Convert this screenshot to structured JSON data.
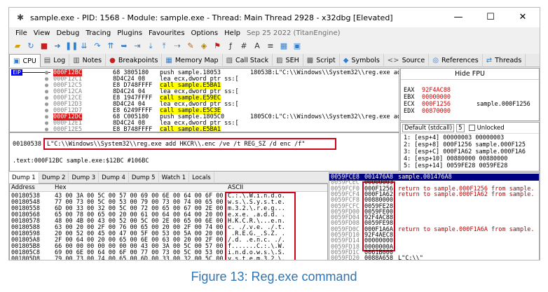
{
  "window": {
    "title": "sample.exe - PID: 1568 - Module: sample.exe - Thread: Main Thread 2928 - x32dbg [Elevated]",
    "minimize_glyph": "—",
    "maximize_glyph": "☐",
    "close_glyph": "✕"
  },
  "menu": {
    "items": [
      "File",
      "View",
      "Debug",
      "Tracing",
      "Plugins",
      "Favourites",
      "Options",
      "Help"
    ],
    "build_date": "Sep 25 2022 (TitanEngine)"
  },
  "toolbar": {
    "icons": [
      "open-icon",
      "restart-icon",
      "close-icon",
      "run-icon",
      "pause-icon",
      "step-into-icon",
      "step-over-icon",
      "step-out-icon",
      "run-to-user-icon",
      "animate-icon",
      "trace-icon",
      "script-icon",
      "patch-icon",
      "comment-icon",
      "label-icon",
      "bookmark-icon",
      "function-icon",
      "hash-icon",
      "font-icon",
      "string-icon",
      "calculator-icon",
      "log-icon"
    ]
  },
  "tabs": [
    {
      "label": "CPU",
      "active": true,
      "icon": "▣"
    },
    {
      "label": "Log",
      "active": false,
      "icon": "▤"
    },
    {
      "label": "Notes",
      "active": false,
      "icon": "▥"
    },
    {
      "label": "Breakpoints",
      "active": false,
      "icon": "●"
    },
    {
      "label": "Memory Map",
      "active": false,
      "icon": "▦"
    },
    {
      "label": "Call Stack",
      "active": false,
      "icon": "▧"
    },
    {
      "label": "SEH",
      "active": false,
      "icon": "▨"
    },
    {
      "label": "Script",
      "active": false,
      "icon": "▩"
    },
    {
      "label": "Symbols",
      "active": false,
      "icon": "◆"
    },
    {
      "label": "Source",
      "active": false,
      "icon": "<>"
    },
    {
      "label": "References",
      "active": false,
      "icon": "◎"
    },
    {
      "label": "Threads",
      "active": false,
      "icon": "⇄"
    }
  ],
  "disasm": {
    "eip_label": "EIP",
    "rows": [
      {
        "addr": "000F12BC",
        "bytes": "68 3805180",
        "ins": "push sample.18053",
        "cmt": "18053B:L\"C:\\\\Windows\\\\System32\\\\reg.exe ad",
        "addr_style": "eip"
      },
      {
        "addr": "000F12C1",
        "bytes": "8D4C24 08",
        "ins": "lea ecx,dword ptr ss:[",
        "cmt": ""
      },
      {
        "addr": "000F12C5",
        "bytes": "E8 D748FFFF",
        "ins": "call sample.E5BA1",
        "cmt": "",
        "call": true
      },
      {
        "addr": "000F12CA",
        "bytes": "8D4C24 04",
        "ins": "lea ecx,dword ptr ss:[",
        "cmt": ""
      },
      {
        "addr": "000F12CE",
        "bytes": "E8 1947FFFF",
        "ins": "call sample.E59EC",
        "cmt": "",
        "call": true
      },
      {
        "addr": "000F12D3",
        "bytes": "8D4C24 04",
        "ins": "lea ecx,dword ptr ss:[",
        "cmt": ""
      },
      {
        "addr": "000F12D7",
        "bytes": "E8 6249FFFF",
        "ins": "call sample.E5C3E",
        "cmt": "",
        "call": true
      },
      {
        "addr": "000F12DC",
        "bytes": "68 C005180",
        "ins": "push sample.1805C0",
        "cmt": "1805C0:L\"C:\\\\Windows\\\\System32\\\\reg.exe ad",
        "addr_style": "red"
      },
      {
        "addr": "000F12E1",
        "bytes": "8D4C24 08",
        "ins": "lea ecx,dword ptr ss:[",
        "cmt": ""
      },
      {
        "addr": "000F12E5",
        "bytes": "E8 B748FFFF",
        "ins": "call sample.E5BA1",
        "cmt": "",
        "call": true
      }
    ]
  },
  "info": {
    "ref_addr": "00180538",
    "ref_string": "L\"C:\\\\Windows\\\\System32\\\\reg.exe add HKCR\\\\.enc /ve /t REG_SZ /d enc /f\"",
    "text_line": ".text:000F12BC sample.exe:$12BC #106BC"
  },
  "registers": {
    "header": "Hide FPU",
    "rows": [
      {
        "name": "EAX",
        "val": "92F4AC88",
        "cmt": ""
      },
      {
        "name": "EBX",
        "val": "00000000",
        "cmt": ""
      },
      {
        "name": "ECX",
        "val": "000F1256",
        "cmt": "sample.000F1256"
      },
      {
        "name": "EDX",
        "val": "00870000",
        "cmt": ""
      }
    ]
  },
  "callconv": {
    "convention": "Default (stdcall)",
    "arg_count": "5",
    "unlocked_label": "Unlocked",
    "rows": [
      "1: [esp+4] 00000003 00000003",
      "2: [esp+8] 000F1256 sample.000F125",
      "3: [esp+C] 000F1A62 sample.000F1A6",
      "4: [esp+10] 00880000 00880000",
      "5: [esp+14] 0059FE28 0059FE28"
    ]
  },
  "dump_tabs": [
    {
      "label": "Dump 1",
      "active": true
    },
    {
      "label": "Dump 2",
      "active": false
    },
    {
      "label": "Dump 3",
      "active": false
    },
    {
      "label": "Dump 4",
      "active": false
    },
    {
      "label": "Dump 5",
      "active": false
    },
    {
      "label": "Watch 1",
      "active": false
    },
    {
      "label": "Locals",
      "active": false
    }
  ],
  "dump": {
    "col_address": "Address",
    "col_hex": "Hex",
    "col_ascii": "ASCII",
    "rows": [
      {
        "addr": "00180538",
        "hex": "43 00 3A 00 5C 00 57 00 69 00 6E 00 64 00 6F 00",
        "asc": "C.:.\\.W.i.n.d.o."
      },
      {
        "addr": "00180548",
        "hex": "77 00 73 00 5C 00 53 00 79 00 73 00 74 00 65 00",
        "asc": "w.s.\\.S.y.s.t.e."
      },
      {
        "addr": "00180558",
        "hex": "6D 00 33 00 32 00 5C 00 72 00 65 00 67 00 2E 00",
        "asc": "m.3.2.\\.r.e.g..."
      },
      {
        "addr": "00180568",
        "hex": "65 00 78 00 65 00 20 00 61 00 64 00 64 00 20 00",
        "asc": "e.x.e. .a.d.d. ."
      },
      {
        "addr": "00180578",
        "hex": "48 00 4B 00 43 00 52 00 5C 00 2E 00 65 00 6E 00",
        "asc": "H.K.C.R.\\...e.n."
      },
      {
        "addr": "00180588",
        "hex": "63 00 20 00 2F 00 76 00 65 00 20 00 2F 00 74 00",
        "asc": "c. ./.v.e. ./.t."
      },
      {
        "addr": "00180598",
        "hex": "20 00 52 00 45 00 47 00 5F 00 53 00 5A 00 20 00",
        "asc": " .R.E.G._.S.Z. ."
      },
      {
        "addr": "001805A8",
        "hex": "2F 00 64 00 20 00 65 00 6E 00 63 00 20 00 2F 00",
        "asc": "/.d. .e.n.c. ./."
      },
      {
        "addr": "001805B8",
        "hex": "66 00 00 00 00 00 00 00 43 00 3A 00 5C 00 57 00",
        "asc": "f.......C.:.\\.W."
      },
      {
        "addr": "001805C8",
        "hex": "69 00 6E 00 64 00 6F 00 77 00 73 00 5C 00 53 00",
        "asc": "i.n.d.o.w.s.\\.S."
      },
      {
        "addr": "001805D8",
        "hex": "79 00 73 00 74 00 65 00 6D 00 33 00 32 00 5C 00",
        "asc": "y.s.t.e.m.3.2.\\."
      }
    ]
  },
  "stack": {
    "rows": [
      {
        "addr": "0059FCE8",
        "val": "001476A8",
        "cmt": "sample.001476A8",
        "red": false,
        "sel": true
      },
      {
        "addr": "0059FCEC",
        "val": "00000003",
        "cmt": "",
        "red": false
      },
      {
        "addr": "0059FCF0",
        "val": "000F1256",
        "cmt": "return to sample.000F1256 from sample.",
        "red": true
      },
      {
        "addr": "0059FCF4",
        "val": "000F1A62",
        "cmt": "return to sample.000F1A62 from sample.",
        "red": true
      },
      {
        "addr": "0059FCF8",
        "val": "00880000",
        "cmt": "",
        "red": false
      },
      {
        "addr": "0059FCFC",
        "val": "0059FE28",
        "cmt": "",
        "red": false
      },
      {
        "addr": "0059FD00",
        "val": "0059FE00",
        "cmt": "",
        "red": false
      },
      {
        "addr": "0059FD04",
        "val": "92F4AC88",
        "cmt": "",
        "red": false
      },
      {
        "addr": "0059FD08",
        "val": "0059FE98",
        "cmt": "",
        "red": false
      },
      {
        "addr": "0059FD0C",
        "val": "000F1A6A",
        "cmt": "return to sample.000F1A6A from sample.",
        "red": true
      },
      {
        "addr": "0059FD10",
        "val": "92F4AEC8",
        "cmt": "",
        "red": false
      },
      {
        "addr": "0059FD14",
        "val": "00000000",
        "cmt": "",
        "red": false
      },
      {
        "addr": "0059FD18",
        "val": "0000000A",
        "cmt": "",
        "red": false
      },
      {
        "addr": "0059FD1C",
        "val": "0061B000",
        "cmt": "",
        "red": false
      },
      {
        "addr": "0059FD20",
        "val": "0088A658",
        "cmt": "L\"C:\\\\\"",
        "red": false
      }
    ]
  },
  "caption": "Figure 13: Reg.exe command",
  "colors": {
    "highlight_red": "#d0021b",
    "call_yellow": "#ffff00",
    "eip_blue": "#0000ff",
    "caption_blue": "#2e75b6"
  }
}
